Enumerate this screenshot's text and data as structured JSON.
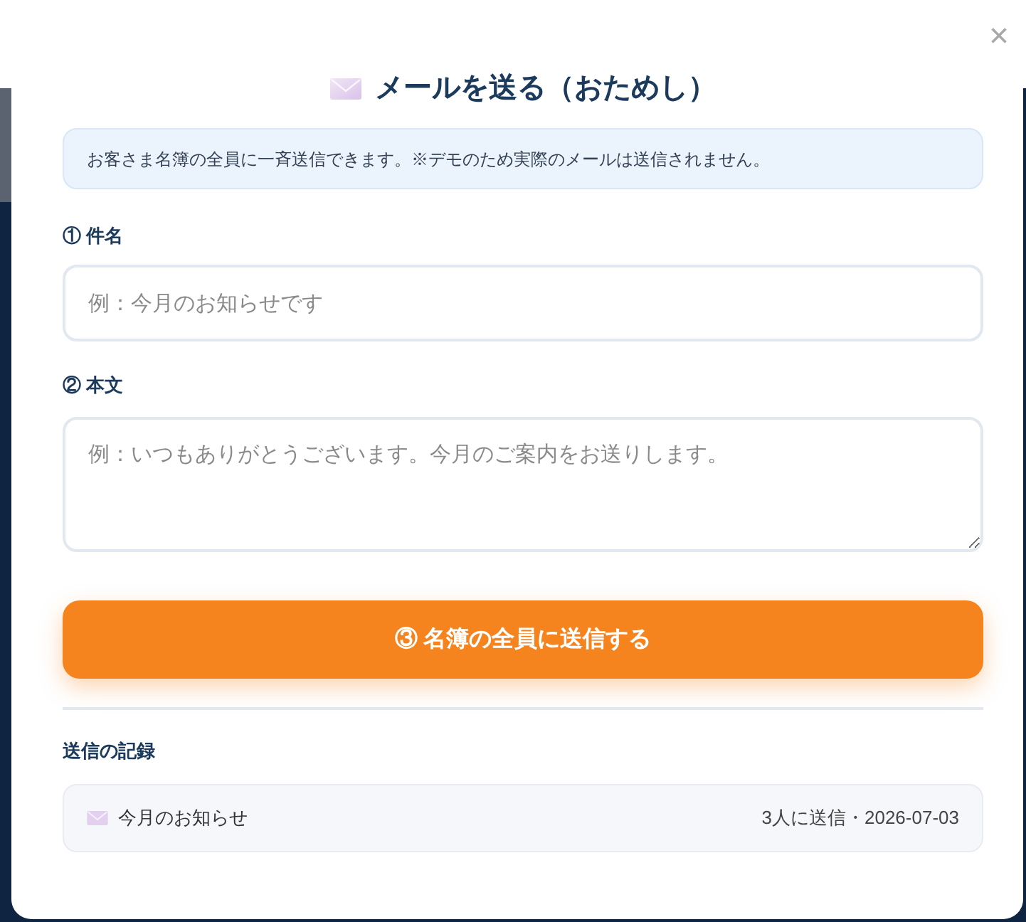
{
  "dialog": {
    "title": "メールを送る（おためし）",
    "close": "×",
    "notice": "お客さま名簿の全員に一斉送信できます。※デモのため実際のメールは送信されません。"
  },
  "fields": [
    {
      "kind": "input",
      "label": "① 件名",
      "placeholder": "例：今月のお知らせです"
    },
    {
      "kind": "textarea",
      "label": "② 本文",
      "placeholder": "例：いつもありがとうございます。今月のご案内をお送りします。"
    }
  ],
  "send_button": "③ 名簿の全員に送信する",
  "history": {
    "title": "送信の記録",
    "items": [
      {
        "subject": "今月のお知らせ",
        "detail": "3人に送信・2026-07-03"
      }
    ]
  }
}
